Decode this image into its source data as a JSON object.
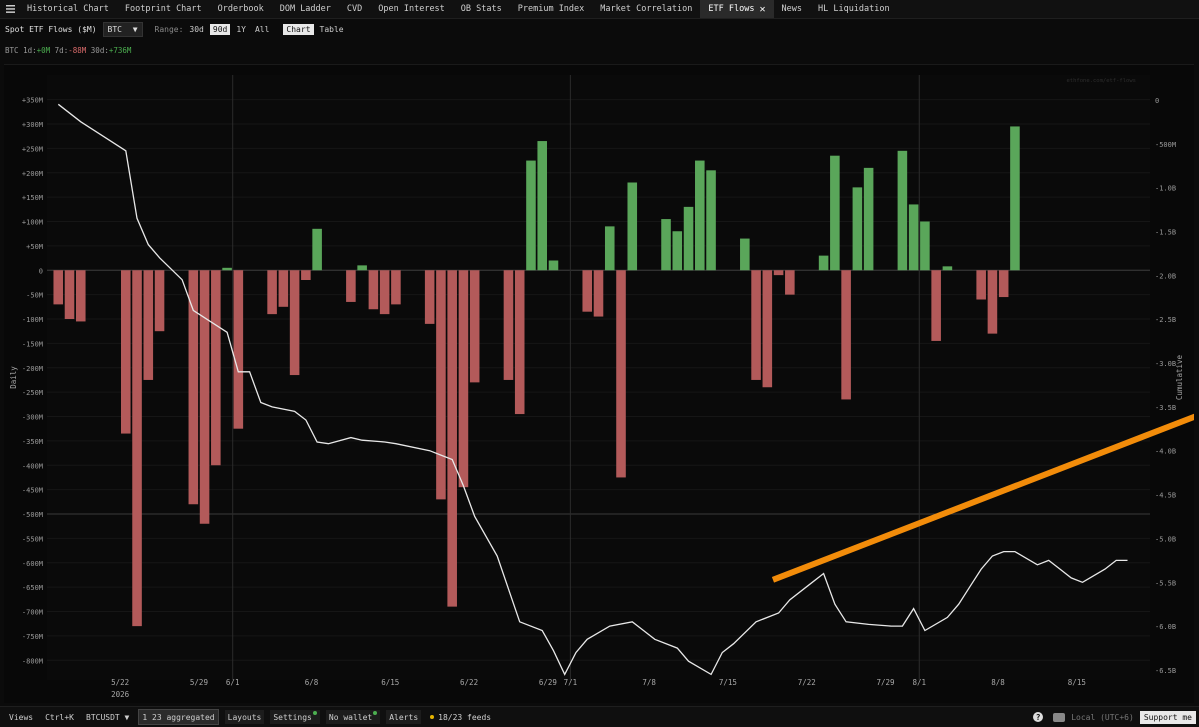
{
  "nav": {
    "menu_icon": "hamburger-icon",
    "items": [
      {
        "label": "Historical Chart"
      },
      {
        "label": "Footprint Chart"
      },
      {
        "label": "Orderbook"
      },
      {
        "label": "DOM Ladder"
      },
      {
        "label": "CVD"
      },
      {
        "label": "Open Interest"
      },
      {
        "label": "OB Stats"
      },
      {
        "label": "Premium Index"
      },
      {
        "label": "Market Correlation"
      },
      {
        "label": "ETF Flows",
        "active": true,
        "close": "✕"
      },
      {
        "label": "News"
      },
      {
        "label": "HL Liquidation"
      }
    ]
  },
  "controls": {
    "title": "Spot ETF Flows ($M)",
    "asset": "BTC",
    "asset_caret": "▼",
    "range_label": "Range:",
    "ranges": [
      "30d",
      "90d",
      "1Y",
      "All"
    ],
    "active_range": "90d",
    "views": [
      "Chart",
      "Table"
    ],
    "active_view": "Chart"
  },
  "stats": {
    "asset": "BTC",
    "d1_label": "1d:",
    "d1": "+0M",
    "d7_label": "7d:",
    "d7": "-88M",
    "d30_label": "30d:",
    "d30": "+736M"
  },
  "chart_data": {
    "type": "bar",
    "left_axis_label": "Daily",
    "right_axis_label": "Cumulative",
    "watermark": "ethfone.com/etf-flows",
    "y_ticks": [
      "+350M",
      "+300M",
      "+250M",
      "+200M",
      "+150M",
      "+100M",
      "+50M",
      "0",
      "-50M",
      "-100M",
      "-150M",
      "-200M",
      "-250M",
      "-300M",
      "-350M",
      "-400M",
      "-450M",
      "-500M",
      "-550M",
      "-600M",
      "-650M",
      "-700M",
      "-750M",
      "-800M"
    ],
    "y_tick_values": [
      350,
      300,
      250,
      200,
      150,
      100,
      50,
      0,
      -50,
      -100,
      -150,
      -200,
      -250,
      -300,
      -350,
      -400,
      -450,
      -500,
      -550,
      -600,
      -650,
      -700,
      -750,
      -800
    ],
    "ylim": [
      -820,
      380
    ],
    "y2_ticks": [
      "0",
      "-500M",
      "-1.0B",
      "-1.5B",
      "-2.0B",
      "-2.5B",
      "-3.0B",
      "-3.5B",
      "-4.0B",
      "-4.5B",
      "-5.0B",
      "-5.5B",
      "-6.0B",
      "-6.5B"
    ],
    "y2_tick_values": [
      0,
      -0.5,
      -1.0,
      -1.5,
      -2.0,
      -2.5,
      -3.0,
      -3.5,
      -4.0,
      -4.5,
      -5.0,
      -5.5,
      -6.0,
      -6.5
    ],
    "y2lim": [
      0.17,
      -6.5
    ],
    "x_ticks": [
      {
        "label": "5/22",
        "day": 6.5
      },
      {
        "label": "5/29",
        "day": 13.5
      },
      {
        "label": "6/1",
        "day": 16.5
      },
      {
        "label": "6/8",
        "day": 23.5
      },
      {
        "label": "6/15",
        "day": 30.5
      },
      {
        "label": "6/22",
        "day": 37.5
      },
      {
        "label": "6/29",
        "day": 44.5
      },
      {
        "label": "7/1",
        "day": 46.5
      },
      {
        "label": "7/8",
        "day": 53.5
      },
      {
        "label": "7/15",
        "day": 60.5
      },
      {
        "label": "7/22",
        "day": 67.5
      },
      {
        "label": "7/29",
        "day": 74.5
      },
      {
        "label": "8/1",
        "day": 77.5
      },
      {
        "label": "8/8",
        "day": 84.5
      },
      {
        "label": "8/15",
        "day": 91.5
      }
    ],
    "year_label": "2026",
    "vlines_days": [
      16.5,
      46.5,
      77.5
    ],
    "hline_value": -500,
    "bar_days": [
      1,
      2,
      3,
      7,
      8,
      9,
      10,
      13,
      14,
      15,
      16,
      17,
      20,
      21,
      22,
      23,
      24,
      27,
      28,
      29,
      30,
      31,
      34,
      35,
      36,
      37,
      38,
      41,
      42,
      43,
      44,
      45,
      48,
      49,
      50,
      51,
      52,
      55,
      56,
      57,
      58,
      59,
      62,
      63,
      64,
      65,
      66,
      69,
      70,
      71,
      72,
      73,
      76,
      77,
      78,
      79,
      80,
      83,
      84,
      85,
      86,
      87,
      90,
      91,
      92,
      93,
      94,
      97
    ],
    "values": [
      -70,
      -100,
      -105,
      -335,
      -730,
      -225,
      -125,
      -480,
      -520,
      -400,
      5,
      -325,
      -90,
      -75,
      -215,
      -20,
      85,
      -65,
      10,
      -80,
      -90,
      -70,
      -110,
      -470,
      -690,
      -445,
      -230,
      -225,
      -295,
      225,
      265,
      20,
      -85,
      -95,
      90,
      -425,
      180,
      105,
      80,
      130,
      225,
      205,
      65,
      -225,
      -240,
      -10,
      -50,
      30,
      235,
      -265,
      170,
      210,
      245,
      135,
      100,
      -145,
      8,
      -60,
      -130,
      -55,
      295
    ],
    "cumulative_x_days": [
      1,
      3,
      7,
      8,
      9,
      10,
      12,
      13,
      16,
      17,
      18,
      19,
      20,
      22,
      23,
      24,
      25,
      27,
      28,
      30,
      31,
      34,
      35,
      36,
      37,
      38,
      40,
      42,
      44,
      45,
      46,
      47,
      48,
      50,
      52,
      53,
      54,
      56,
      57,
      59,
      60,
      61,
      63,
      65,
      66,
      68,
      69,
      70,
      71,
      73,
      75,
      76,
      77,
      78,
      80,
      81,
      82,
      83,
      84,
      85,
      86,
      88,
      89,
      90,
      91,
      92,
      94,
      95,
      96
    ],
    "cumulative_values": [
      -0.05,
      -0.25,
      -0.58,
      -1.35,
      -1.65,
      -1.8,
      -2.05,
      -2.4,
      -2.65,
      -3.1,
      -3.1,
      -3.45,
      -3.5,
      -3.55,
      -3.65,
      -3.9,
      -3.92,
      -3.85,
      -3.88,
      -3.9,
      -3.92,
      -4.0,
      -4.05,
      -4.1,
      -4.4,
      -4.75,
      -5.2,
      -5.95,
      -6.05,
      -6.28,
      -6.55,
      -6.3,
      -6.15,
      -6.0,
      -5.95,
      -6.05,
      -6.15,
      -6.25,
      -6.4,
      -6.55,
      -6.3,
      -6.2,
      -5.95,
      -5.85,
      -5.7,
      -5.5,
      -5.4,
      -5.75,
      -5.95,
      -5.98,
      -6.0,
      -6.0,
      -5.8,
      -6.05,
      -5.9,
      -5.75,
      -5.55,
      -5.35,
      -5.2,
      -5.15,
      -5.15,
      -5.3,
      -5.25,
      -5.35,
      -5.45,
      -5.5,
      -5.35,
      -5.25,
      -5.25
    ],
    "annotation": {
      "type": "arrow",
      "color": "#f28c0a",
      "from": [
        64.5,
        -635
      ],
      "to": [
        116,
        -175
      ]
    }
  },
  "bottom": {
    "views": "Views",
    "shortcut": "Ctrl+K",
    "symbol": "BTCUSDT",
    "symbol_caret": "▼",
    "aggregated_count": "1 23 aggregated",
    "layouts": "Layouts",
    "settings": "Settings",
    "wallet": "No wallet",
    "alerts": "Alerts",
    "feeds": "18/23 feeds",
    "help": "?",
    "timezone": "Local (UTC+6)",
    "support": "Support me"
  },
  "colors": {
    "positive": "#5aa65a",
    "negative": "#b35a5a",
    "line": "#e8e8e8",
    "arrow": "#f28c0a",
    "background": "#0b0b0b"
  }
}
